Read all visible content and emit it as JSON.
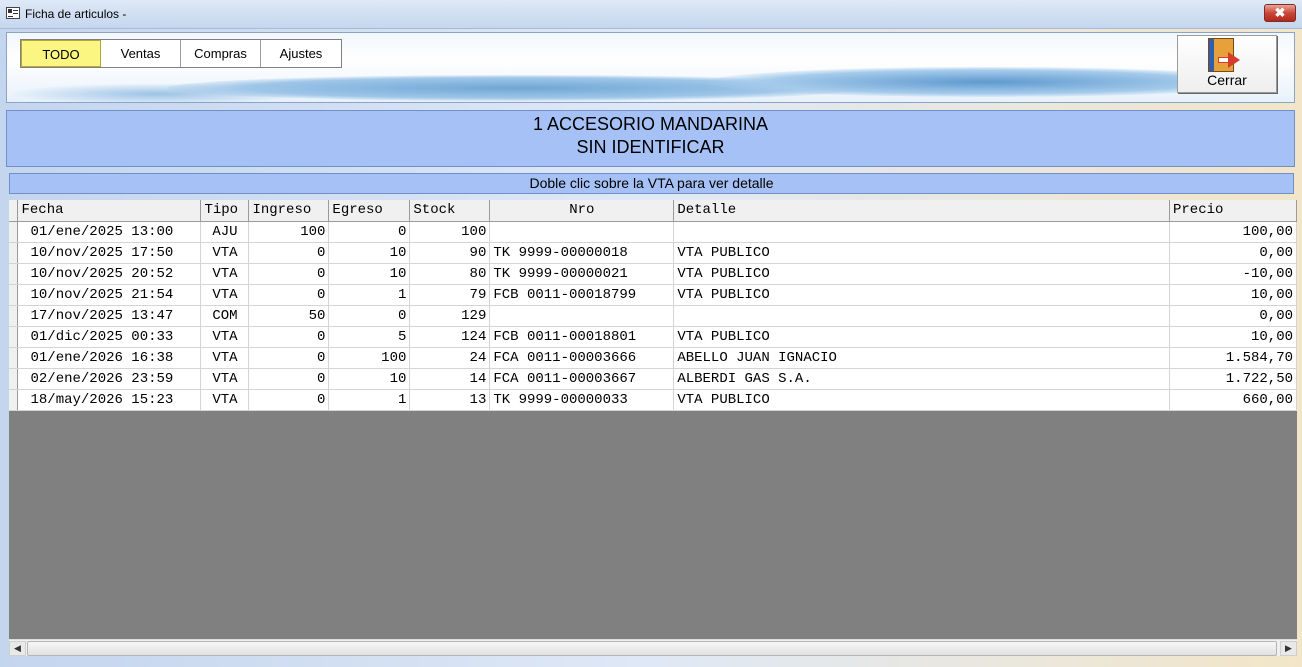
{
  "window": {
    "title": "Ficha de articulos -",
    "close_symbol": "✖"
  },
  "toolbar": {
    "tabs": [
      {
        "label": "TODO",
        "active": true
      },
      {
        "label": "Ventas",
        "active": false
      },
      {
        "label": "Compras",
        "active": false
      },
      {
        "label": "Ajustes",
        "active": false
      }
    ],
    "close_label": "Cerrar"
  },
  "header": {
    "line1": "1 ACCESORIO MANDARINA",
    "line2": "SIN IDENTIFICAR"
  },
  "hint": "Doble clic sobre la VTA para ver detalle",
  "grid": {
    "columns": [
      "Fecha",
      "Tipo",
      "Ingreso",
      "Egreso",
      "Stock",
      "Nro",
      "Detalle",
      "Precio"
    ],
    "rows": [
      [
        "01/ene/2025 13:00",
        "AJU",
        "100",
        "0",
        "100",
        "",
        "",
        "100,00"
      ],
      [
        "10/nov/2025 17:50",
        "VTA",
        "0",
        "10",
        "90",
        "TK 9999-00000018",
        "VTA PUBLICO",
        "0,00"
      ],
      [
        "10/nov/2025 20:52",
        "VTA",
        "0",
        "10",
        "80",
        "TK 9999-00000021",
        "VTA PUBLICO",
        "-10,00"
      ],
      [
        "10/nov/2025 21:54",
        "VTA",
        "0",
        "1",
        "79",
        "FCB 0011-00018799",
        "VTA PUBLICO",
        "10,00"
      ],
      [
        "17/nov/2025 13:47",
        "COM",
        "50",
        "0",
        "129",
        "",
        "",
        "0,00"
      ],
      [
        "01/dic/2025 00:33",
        "VTA",
        "0",
        "5",
        "124",
        "FCB 0011-00018801",
        "VTA PUBLICO",
        "10,00"
      ],
      [
        "01/ene/2026 16:38",
        "VTA",
        "0",
        "100",
        "24",
        "FCA 0011-00003666",
        "ABELLO JUAN IGNACIO",
        "1.584,70"
      ],
      [
        "02/ene/2026 23:59",
        "VTA",
        "0",
        "10",
        "14",
        "FCA 0011-00003667",
        "ALBERDI GAS S.A.",
        "1.722,50"
      ],
      [
        "18/may/2026 15:23",
        "VTA",
        "0",
        "1",
        "13",
        "TK 9999-00000033",
        "VTA PUBLICO",
        "660,00"
      ]
    ]
  },
  "scrollbar": {
    "left_arrow": "◀",
    "right_arrow": "▶"
  }
}
